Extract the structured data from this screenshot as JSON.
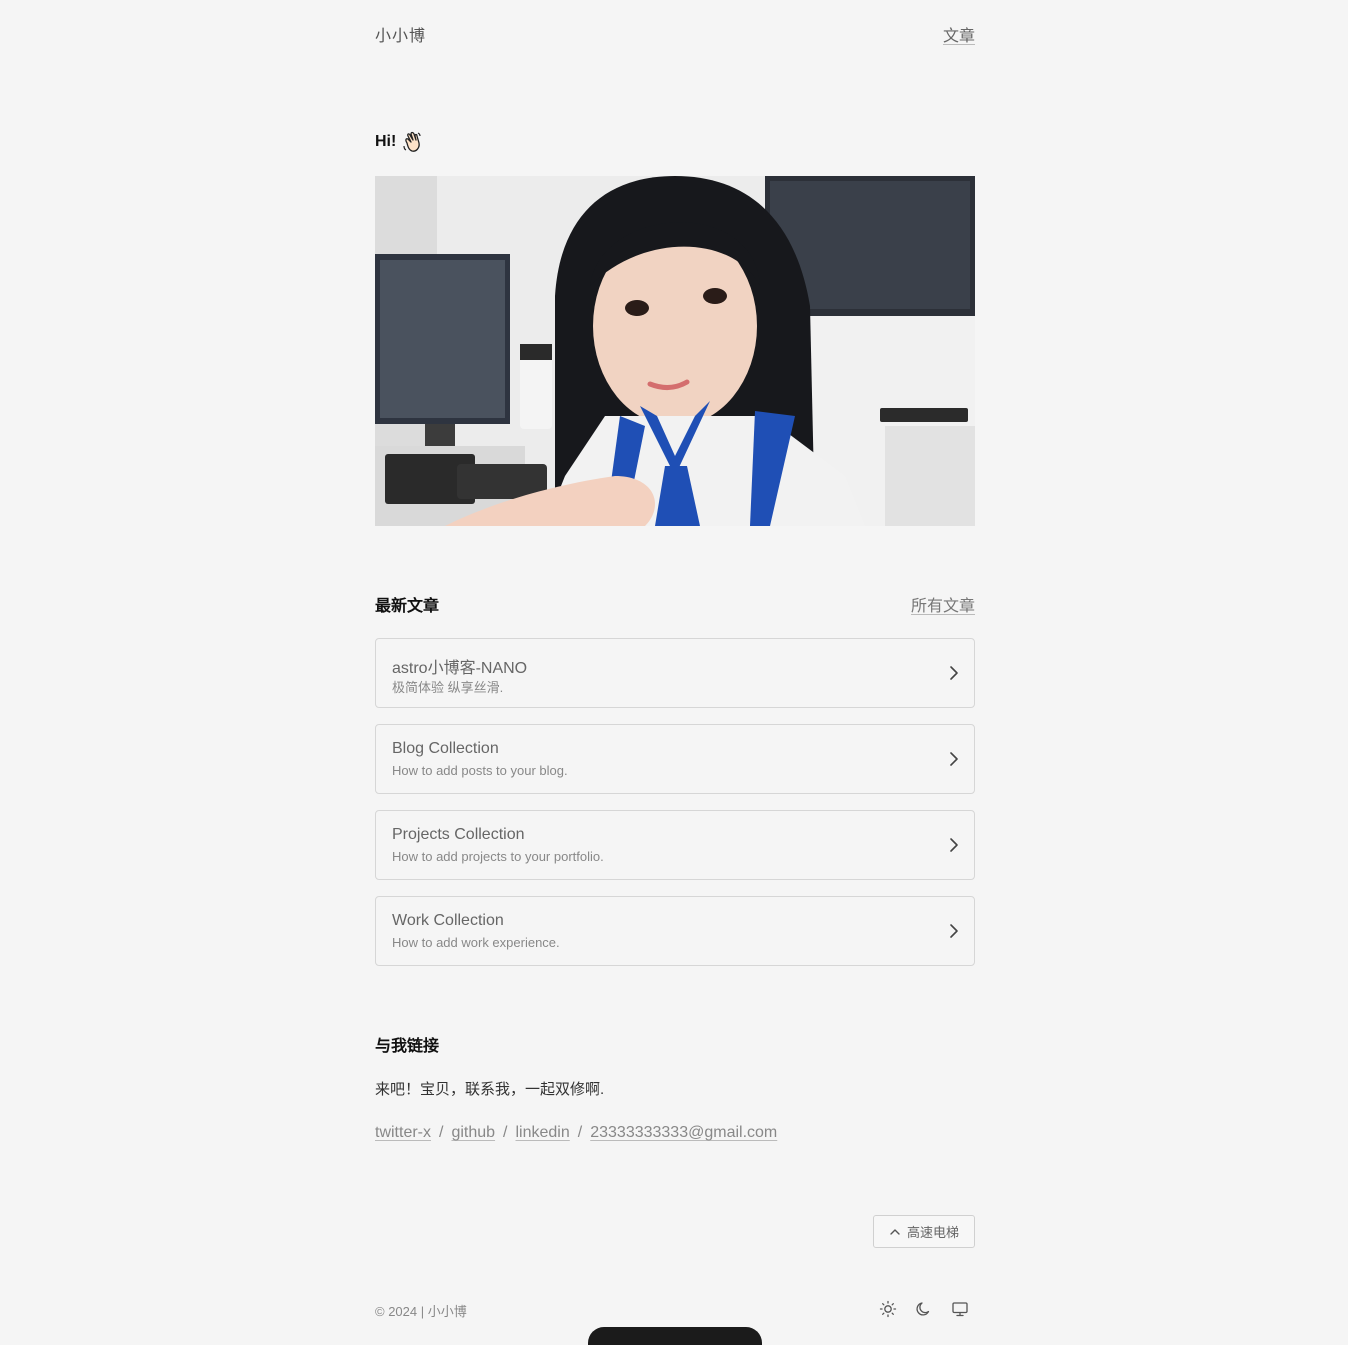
{
  "header": {
    "site_title": "小小博",
    "nav_articles": "文章"
  },
  "hero": {
    "greeting": "Hi!",
    "wave_icon": "waving-hand-icon"
  },
  "latest": {
    "title": "最新文章",
    "all_posts": "所有文章",
    "posts": [
      {
        "title": "astro小博客-NANO",
        "desc": "极简体验 纵享丝滑."
      },
      {
        "title": "Blog Collection",
        "desc": "How to add posts to your blog."
      },
      {
        "title": "Projects Collection",
        "desc": "How to add projects to your portfolio."
      },
      {
        "title": "Work Collection",
        "desc": "How to add work experience."
      }
    ]
  },
  "contact": {
    "title": "与我链接",
    "text": "来吧！宝贝，联系我，一起双修啊.",
    "links": [
      "twitter-x",
      "github",
      "linkedin",
      "23333333333@gmail.com"
    ],
    "separator": "/"
  },
  "back_to_top": {
    "label": "高速电梯"
  },
  "footer": {
    "copyright": "© 2024 | 小小博",
    "theme_icons": [
      "sun-icon",
      "moon-icon",
      "monitor-icon"
    ]
  },
  "colors": {
    "background": "#f5f5f5",
    "border": "#d6d6d6",
    "accent_blue": "#1f4fb5"
  }
}
